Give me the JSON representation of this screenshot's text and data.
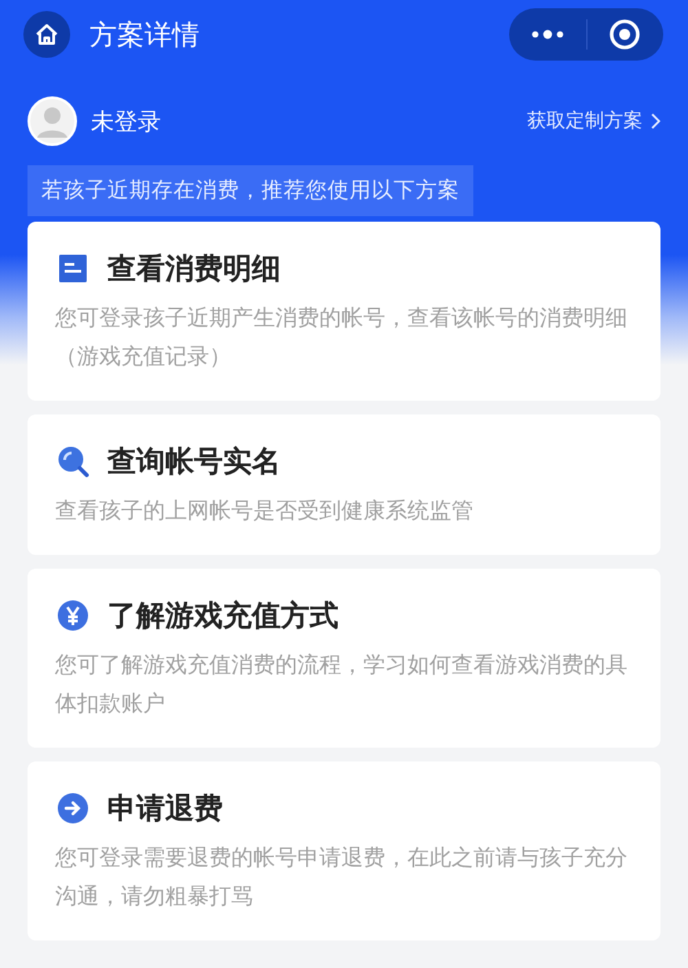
{
  "nav": {
    "title": "方案详情"
  },
  "user": {
    "name": "未登录",
    "action": "获取定制方案"
  },
  "notice": "若孩子近期存在消费，推荐您使用以下方案",
  "cards": [
    {
      "kind": "document",
      "title": "查看消费明细",
      "description": "您可登录孩子近期产生消费的帐号，查看该帐号的消费明细（游戏充值记录）"
    },
    {
      "kind": "search",
      "title": "查询帐号实名",
      "description": "查看孩子的上网帐号是否受到健康系统监管"
    },
    {
      "kind": "yen",
      "title": "了解游戏充值方式",
      "description": "您可了解游戏充值消费的流程，学习如何查看游戏消费的具体扣款账户"
    },
    {
      "kind": "arrow",
      "title": "申请退费",
      "description": "您可登录需要退费的帐号申请退费，在此之前请与孩子充分沟通，请勿粗暴打骂"
    }
  ]
}
